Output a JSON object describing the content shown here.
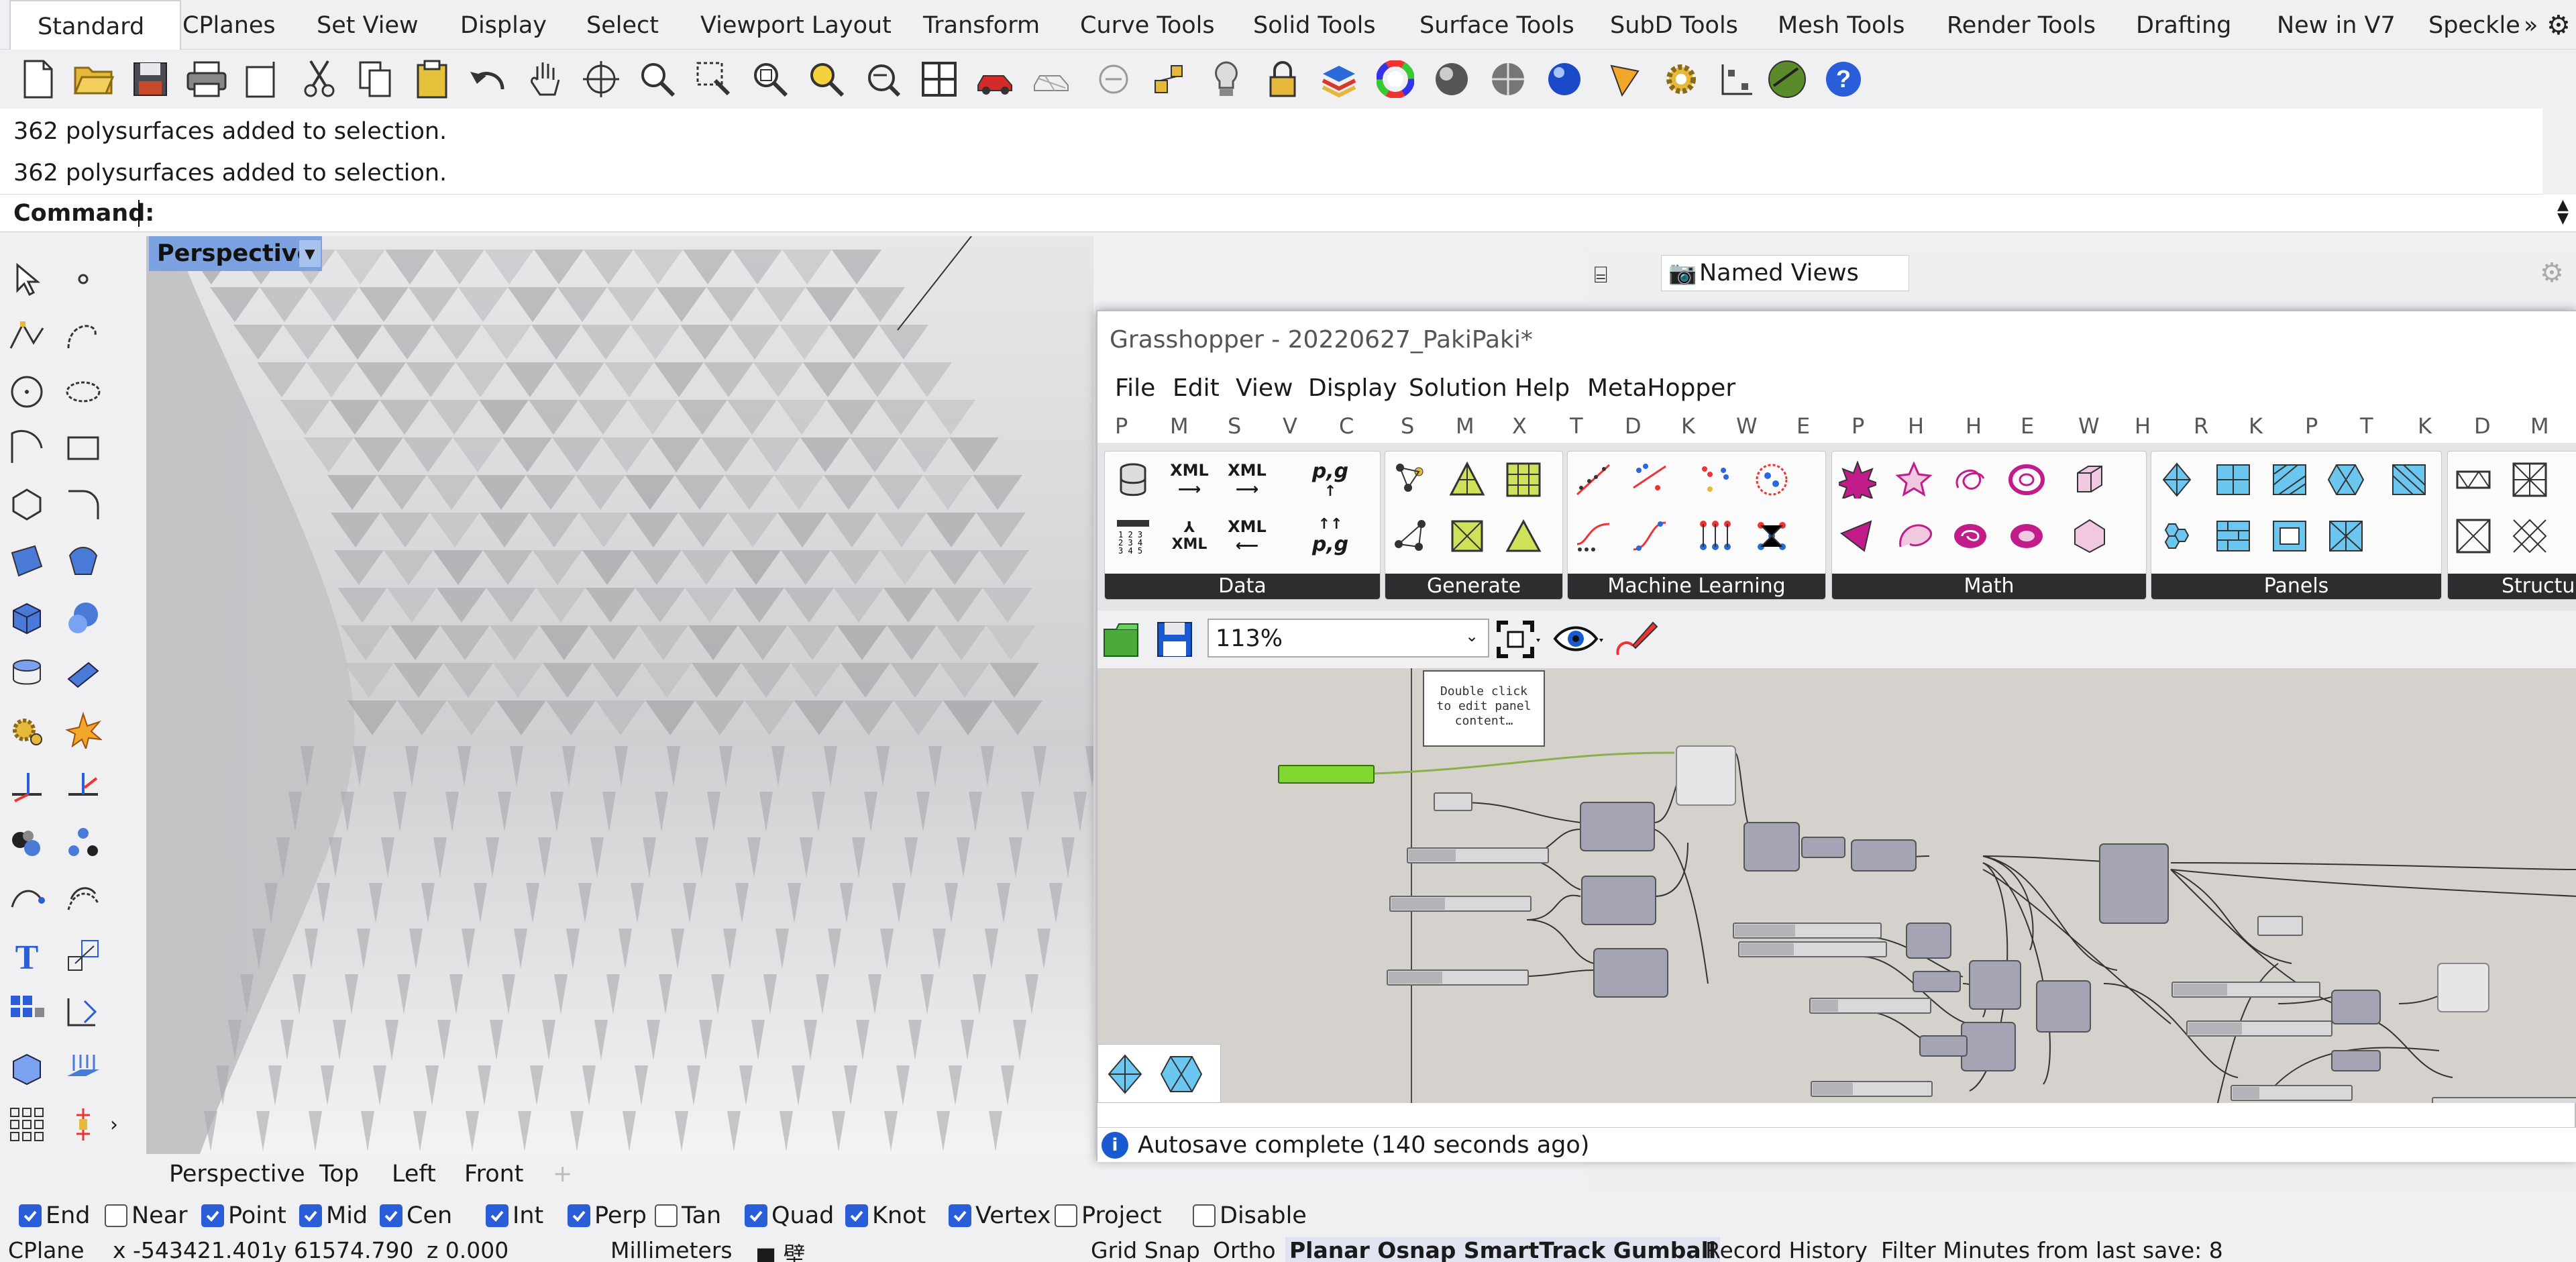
{
  "ribbon_tabs": [
    "Standard",
    "CPlanes",
    "Set View",
    "Display",
    "Select",
    "Viewport Layout",
    "Transform",
    "Curve Tools",
    "Solid Tools",
    "Surface Tools",
    "SubD Tools",
    "Mesh Tools",
    "Render Tools",
    "Drafting",
    "New in V7",
    "Speckle"
  ],
  "ribbon_more": "»",
  "history": [
    "362 polysurfaces added to selection.",
    "362 polysurfaces added to selection."
  ],
  "command": {
    "label": "Command:",
    "value": ""
  },
  "viewport": {
    "title": "Perspective"
  },
  "viewport_tabs": [
    "Perspective",
    "Top",
    "Left",
    "Front"
  ],
  "right_panel": {
    "title": "Named Views"
  },
  "grasshopper": {
    "title": "Grasshopper - 20220627_PakiPaki*",
    "menu": [
      "File",
      "Edit",
      "View",
      "Display",
      "Solution",
      "Help",
      "MetaHopper"
    ],
    "category_letters": [
      "P",
      "M",
      "S",
      "V",
      "C",
      "S",
      "M",
      "X",
      "T",
      "D",
      "K",
      "W",
      "E",
      "P",
      "H",
      "H",
      "E",
      "W",
      "H",
      "R",
      "K",
      "P",
      "T",
      "K",
      "D",
      "M"
    ],
    "groups": [
      "Data",
      "Generate",
      "Machine Learning",
      "Math",
      "Panels",
      "Structu"
    ],
    "icon_labels": {
      "xml1": "XML",
      "xml2": "XML",
      "xml3": "XML",
      "xml4": "XML",
      "pg1": "p,g",
      "pg2": "p,g"
    },
    "zoom": "113%",
    "panel_text": "Double click\nto edit panel\ncontent…",
    "status": "Autosave complete (140 seconds ago)"
  },
  "osnaps": [
    {
      "label": "End",
      "checked": true
    },
    {
      "label": "Near",
      "checked": false
    },
    {
      "label": "Point",
      "checked": true
    },
    {
      "label": "Mid",
      "checked": true
    },
    {
      "label": "Cen",
      "checked": true
    },
    {
      "label": "Int",
      "checked": true
    },
    {
      "label": "Perp",
      "checked": true
    },
    {
      "label": "Tan",
      "checked": false
    },
    {
      "label": "Quad",
      "checked": true
    },
    {
      "label": "Knot",
      "checked": true
    },
    {
      "label": "Vertex",
      "checked": true
    },
    {
      "label": "Project",
      "checked": false
    },
    {
      "label": "Disable",
      "checked": false
    }
  ],
  "status_bar": {
    "cplane": "CPlane",
    "x": "x -543421.401",
    "y": "y 61574.790",
    "z": "z 0.000",
    "units": "Millimeters",
    "layer": "■ 壁",
    "grid_snap": "Grid Snap",
    "ortho": "Ortho",
    "planar_group": "Planar  Osnap  SmartTrack  Gumball",
    "record": "Record History",
    "filter": "Filter  Minutes from last save: 8"
  }
}
